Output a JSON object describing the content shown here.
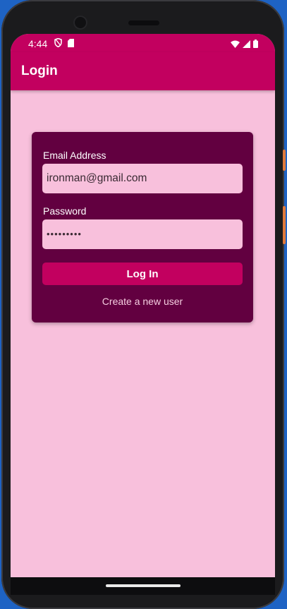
{
  "status_bar": {
    "time": "4:44",
    "icons_left": [
      "shield-icon",
      "sd-card-icon"
    ],
    "icons_right": [
      "wifi-icon",
      "signal-icon",
      "battery-icon"
    ]
  },
  "app_bar": {
    "title": "Login"
  },
  "login_form": {
    "email_label": "Email Address",
    "email_value": "ironman@gmail.com",
    "password_label": "Password",
    "password_value": "•••••••••",
    "login_button": "Log In",
    "create_user_link": "Create a new user"
  },
  "colors": {
    "primary": "#c2005f",
    "background": "#f8c0dc",
    "card": "#620040"
  }
}
